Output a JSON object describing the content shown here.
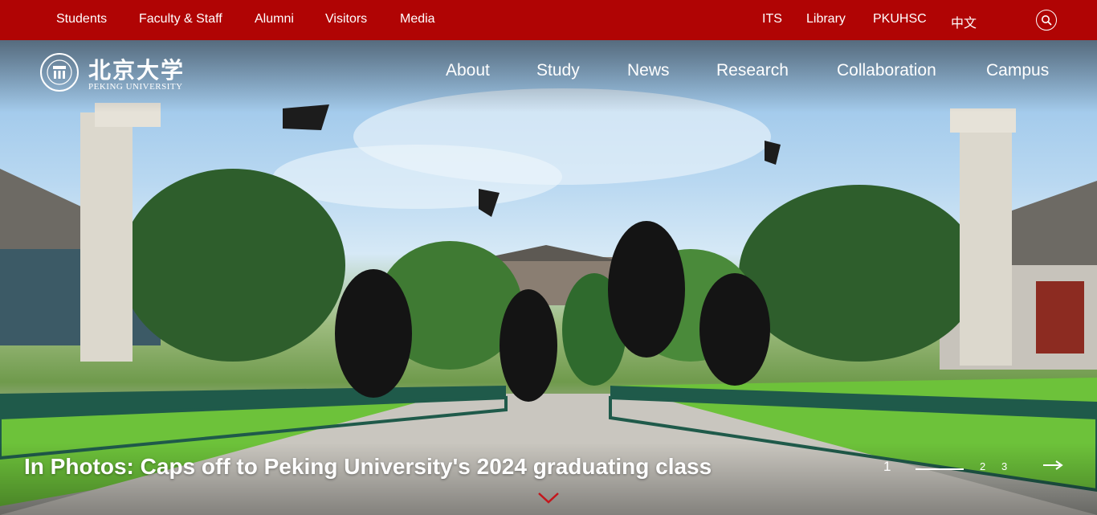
{
  "topbar": {
    "left_links": [
      "Students",
      "Faculty & Staff",
      "Alumni",
      "Visitors",
      "Media"
    ],
    "right_links": [
      "ITS",
      "Library",
      "PKUHSC",
      "中文"
    ],
    "search_icon": "search-icon"
  },
  "logo": {
    "chinese": "北京大学",
    "english": "PEKING UNIVERSITY"
  },
  "nav": {
    "items": [
      "About",
      "Study",
      "News",
      "Research",
      "Collaboration",
      "Campus"
    ]
  },
  "hero": {
    "caption": "In Photos: Caps off to Peking University's 2024 graduating class",
    "pager": {
      "current": "1",
      "others": [
        "2",
        "3"
      ]
    },
    "next_icon": "arrow-right-icon",
    "scroll_icon": "chevron-down-icon"
  },
  "colors": {
    "brand_red": "#b00404",
    "text_white": "#ffffff"
  }
}
